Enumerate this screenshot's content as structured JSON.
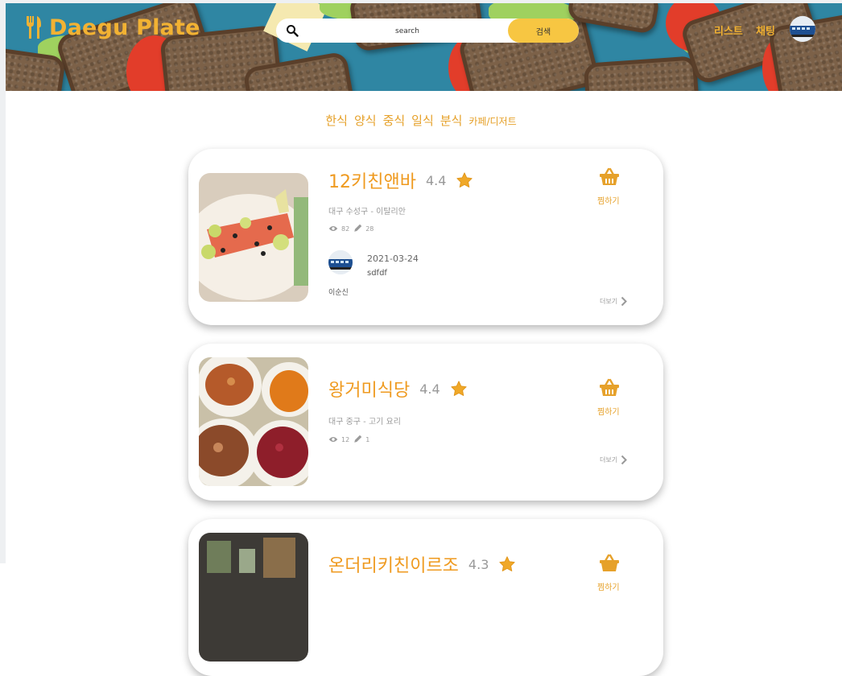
{
  "colors": {
    "accent": "#f2b233",
    "search_button": "#f7c642",
    "title": "#ef9a1f",
    "muted": "#9a9a9a"
  },
  "header": {
    "logo_text": "Daegu Plate",
    "search_placeholder": "search",
    "search_button": "검색",
    "nav": [
      "리스트",
      "채팅"
    ]
  },
  "categories": [
    "한식",
    "양식",
    "중식",
    "일식",
    "분식",
    "카페/디저트"
  ],
  "restaurants": [
    {
      "name": "12키친앤바",
      "rating": "4.4",
      "location": "대구 수성구 - 이탈리안",
      "views": "82",
      "reviews": "28",
      "pick_label": "찜하기",
      "more_label": "더보기",
      "review": {
        "date": "2021-03-24",
        "user": "sdfdf",
        "text": "이순신"
      }
    },
    {
      "name": "왕거미식당",
      "rating": "4.4",
      "location": "대구 중구 - 고기 요리",
      "views": "12",
      "reviews": "1",
      "pick_label": "찜하기",
      "more_label": "더보기"
    },
    {
      "name": "온더리키친이르조",
      "rating": "4.3",
      "pick_label": "찜하기"
    }
  ],
  "icons": {
    "logo": "fork-spoon-icon",
    "search": "search-icon",
    "rating": "star-icon",
    "views": "eye-icon",
    "reviews": "pencil-icon",
    "pick": "basket-icon",
    "more": "chevron-right-icon"
  }
}
